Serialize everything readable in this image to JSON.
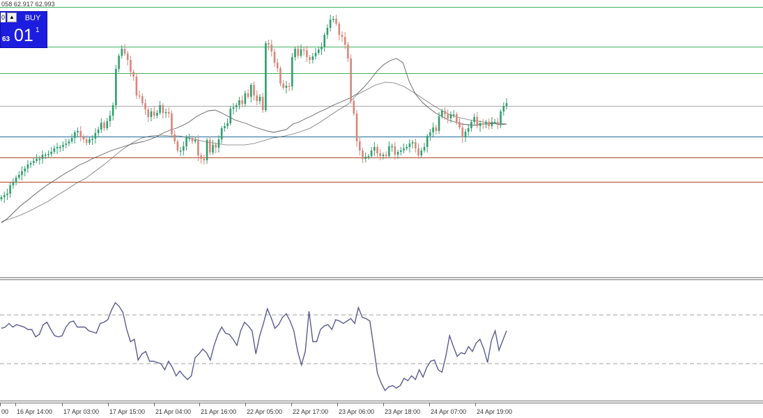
{
  "header": {
    "ohlc_text": "058 62.917 62.993"
  },
  "trade_panel": {
    "close_label": "0",
    "arrow_label": "▲",
    "buy_label": "BUY",
    "price_small": "63",
    "price_big": "01",
    "price_sup": "1"
  },
  "colors": {
    "bull": "#2e9f6c",
    "bear": "#d98579",
    "ma": "#555555",
    "rsi": "#5a5a90",
    "level_green": "#3fb35f",
    "level_gray": "#a8a8a8",
    "level_blue": "#1c6b9a",
    "level_red": "#b0402a",
    "separator": "#888888"
  },
  "chart_data": [
    {
      "type": "candlestick",
      "title": "",
      "x_tick_labels": [
        "00",
        "16 Apr 14:00",
        "17 Apr 03:00",
        "17 Apr 15:00",
        "21 Apr 04:00",
        "21 Apr 16:00",
        "22 Apr 05:00",
        "22 Apr 17:00",
        "23 Apr 06:00",
        "23 Apr 18:00",
        "24 Apr 07:00",
        "24 Apr 19:00"
      ],
      "ylim": [
        0,
        400
      ],
      "grid": false,
      "series": [
        {
          "kind": "close",
          "values": [
            283,
            280,
            278,
            266,
            262,
            255,
            251,
            246,
            242,
            236,
            234,
            231,
            228,
            228,
            222,
            222,
            221,
            218,
            213,
            211,
            211,
            208,
            206,
            203,
            198,
            190,
            188,
            197,
            200,
            205,
            200,
            199,
            191,
            186,
            176,
            184,
            174,
            166,
            151,
            99,
            80,
            70,
            77,
            86,
            103,
            110,
            137,
            138,
            148,
            157,
            168,
            160,
            166,
            162,
            151,
            162,
            161,
            163,
            193,
            203,
            216,
            216,
            210,
            198,
            198,
            203,
            201,
            223,
            228,
            230,
            201,
            219,
            208,
            212,
            200,
            184,
            181,
            177,
            156,
            154,
            151,
            144,
            149,
            134,
            139,
            122,
            137,
            145,
            139,
            158,
            62,
            64,
            74,
            90,
            98,
            120,
            126,
            123,
            124,
            82,
            70,
            80,
            71,
            72,
            82,
            86,
            81,
            76,
            71,
            67,
            50,
            40,
            28,
            27,
            34,
            50,
            53,
            64,
            84,
            145,
            163,
            203,
            216,
            228,
            225,
            224,
            216,
            211,
            220,
            224,
            222,
            224,
            210,
            210,
            222,
            218,
            216,
            213,
            211,
            206,
            204,
            213,
            223,
            216,
            211,
            195,
            190,
            183,
            188,
            167,
            159,
            164,
            170,
            164,
            164,
            175,
            183,
            197,
            189,
            184,
            175,
            168,
            181,
            177,
            178,
            175,
            181,
            175,
            175,
            177,
            160,
            152,
            148
          ]
        },
        {
          "kind": "ma_fast",
          "values": [
            320,
            313,
            304,
            295,
            288,
            280,
            273,
            266,
            260,
            254,
            248,
            243,
            237,
            233,
            228,
            224,
            220,
            216,
            213,
            210,
            207,
            205,
            203,
            200,
            196,
            191,
            187,
            184,
            180,
            175,
            168,
            163,
            159,
            158,
            162,
            167,
            172,
            175,
            178,
            182,
            185,
            188,
            190,
            188,
            186,
            178,
            175,
            170,
            166,
            161,
            157,
            152,
            148,
            144,
            140,
            134,
            125,
            114,
            102,
            93,
            87,
            84,
            90,
            118,
            136,
            147,
            155,
            162,
            167,
            172,
            175,
            178,
            179,
            180,
            178,
            178,
            177,
            179,
            178
          ]
        },
        {
          "kind": "ma_slow",
          "values": [
            318,
            314,
            309,
            303,
            296,
            289,
            280,
            272,
            263,
            256,
            246,
            236,
            225,
            214,
            205,
            198,
            195,
            194,
            195,
            195,
            198,
            201,
            204,
            206,
            208,
            208,
            208,
            206,
            202,
            198,
            196,
            193,
            189,
            184,
            176,
            167,
            158,
            150,
            136,
            129,
            122,
            118,
            119,
            124,
            132,
            141,
            150,
            158,
            165,
            169,
            172,
            174,
            176,
            177,
            178
          ]
        }
      ]
    },
    {
      "type": "line",
      "title": "",
      "ylim": [
        0,
        100
      ],
      "levels": [
        70,
        30
      ],
      "series": [
        {
          "kind": "oscillator",
          "values": [
            59,
            60,
            63,
            60,
            62,
            61,
            60,
            58,
            58,
            52,
            54,
            62,
            64,
            58,
            53,
            52,
            53,
            60,
            64,
            65,
            60,
            60,
            60,
            57,
            56,
            55,
            63,
            64,
            66,
            74,
            80,
            77,
            72,
            58,
            48,
            50,
            33,
            38,
            40,
            32,
            32,
            31,
            30,
            25,
            32,
            27,
            20,
            24,
            20,
            17,
            20,
            35,
            38,
            42,
            39,
            33,
            45,
            54,
            60,
            55,
            54,
            50,
            45,
            57,
            64,
            61,
            57,
            38,
            53,
            63,
            75,
            68,
            59,
            62,
            68,
            71,
            65,
            57,
            40,
            29,
            40,
            73,
            48,
            48,
            58,
            61,
            62,
            58,
            66,
            65,
            63,
            65,
            67,
            63,
            76,
            68,
            67,
            65,
            44,
            22,
            14,
            8,
            11,
            12,
            10,
            12,
            18,
            16,
            20,
            17,
            25,
            19,
            27,
            32,
            33,
            25,
            23,
            36,
            53,
            44,
            36,
            39,
            38,
            44,
            40,
            47,
            50,
            42,
            31,
            49,
            57,
            41,
            49,
            57
          ]
        }
      ]
    }
  ]
}
